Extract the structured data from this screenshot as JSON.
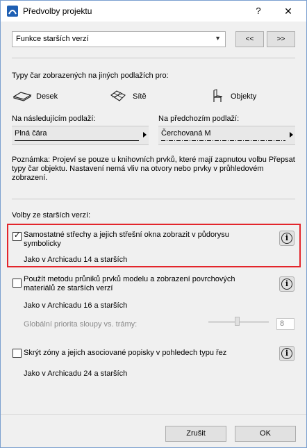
{
  "window": {
    "title": "Předvolby projektu",
    "help": "?",
    "close": "✕"
  },
  "top": {
    "select_value": "Funkce starších verzí",
    "prev": "<<",
    "next": ">>"
  },
  "linetypes": {
    "heading": "Typy čar zobrazených na jiných podlažích pro:",
    "items": [
      "Desek",
      "Sítě",
      "Objekty"
    ]
  },
  "floors": {
    "next_label": "Na následujícím podlaží:",
    "next_value": "Plná čára",
    "prev_label": "Na předchozím podlaží:",
    "prev_value": "Čerchovaná M"
  },
  "note": "Poznámka: Projeví se pouze u knihovních prvků, které mají zapnutou volbu Přepsat typy čar objektu. Nastavení nemá vliv na otvory nebo prvky v průhledovém zobrazení.",
  "legacy": {
    "heading": "Volby ze starších verzí:",
    "options": [
      {
        "label": "Samostatné střechy a jejich střešní okna zobrazit v půdorysu symbolicky",
        "checked": true,
        "sub": "Jako v Archicadu 14 a starších"
      },
      {
        "label": "Použít metodu průniků prvků modelu a zobrazení povrchových materiálů ze starších verzí",
        "checked": false,
        "sub": "Jako v Archicadu 16 a starších"
      },
      {
        "label": "Skrýt zóny a jejich asociované popisky v pohledech typu řez",
        "checked": false,
        "sub": "Jako v Archicadu 24 a starších"
      }
    ],
    "priority_label": "Globální priorita sloupy vs. trámy:",
    "priority_value": "8",
    "priority_fraction": 0.47
  },
  "buttons": {
    "cancel": "Zrušit",
    "ok": "OK"
  },
  "colors": {
    "highlight": "#e3252b",
    "window_border": "#7a9fcf"
  }
}
